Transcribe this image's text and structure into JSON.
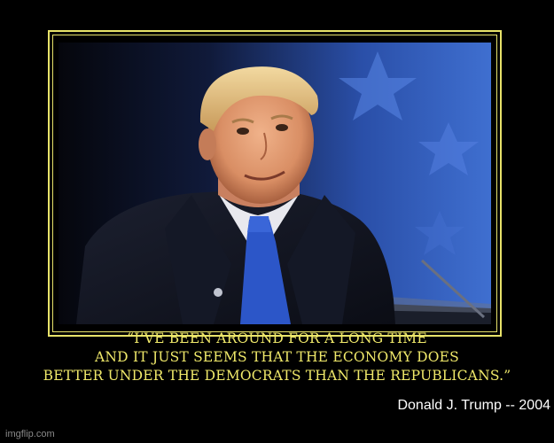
{
  "quote": {
    "line1": "“I’VE BEEN AROUND FOR A LONG TIME",
    "line2": "AND IT JUST SEEMS THAT THE ECONOMY DOES",
    "line3": "BETTER UNDER THE DEMOCRATS THAN THE REPUBLICANS.”"
  },
  "attribution": "Donald J. Trump -- 2004",
  "watermark": "imgflip.com",
  "colors": {
    "frame": "#e8e36a",
    "quote_text": "#f0e96a",
    "background": "#000000",
    "attribution_text": "#ffffff"
  },
  "photo": {
    "subject": "portrait-photo"
  }
}
